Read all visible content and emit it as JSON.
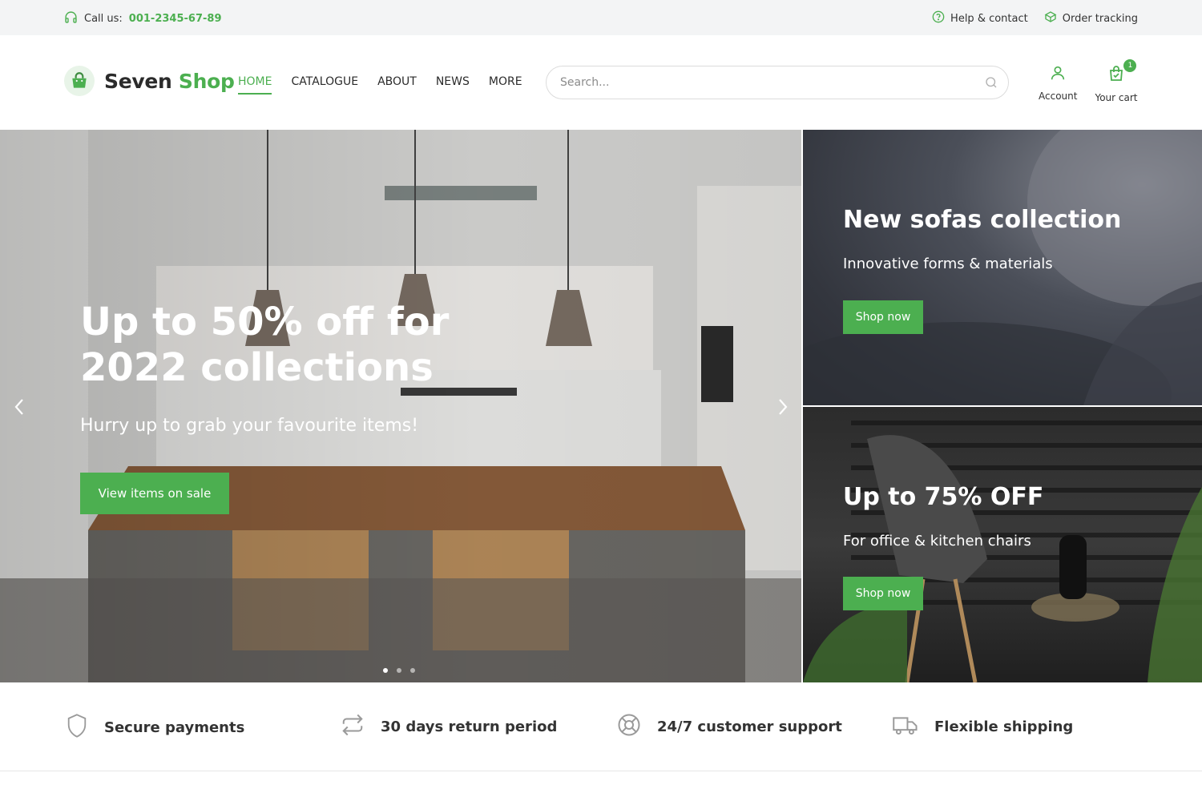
{
  "topbar": {
    "call_label": "Call us:",
    "phone": "001-2345-67-89",
    "help": "Help & contact",
    "tracking": "Order tracking"
  },
  "header": {
    "brand_part1": "Seven",
    "brand_part2": "Shop",
    "nav": [
      "HOME",
      "CATALOGUE",
      "ABOUT",
      "NEWS",
      "MORE"
    ],
    "active_nav": "HOME",
    "search_placeholder": "Search...",
    "account_label": "Account",
    "cart_label": "Your cart",
    "cart_count": "1"
  },
  "hero": {
    "title": "Up to 50% off for 2022 collections",
    "subtitle": "Hurry up to grab your favourite items!",
    "cta": "View items on sale",
    "slide_count": 3,
    "active_slide": 1
  },
  "promos": [
    {
      "title": "New sofas collection",
      "subtitle": "Innovative forms & materials",
      "button": "Shop now"
    },
    {
      "title": "Up to 75% OFF",
      "subtitle": "For office & kitchen chairs",
      "button": "Shop now"
    }
  ],
  "features": [
    {
      "label": "Secure payments",
      "icon": "shield-icon"
    },
    {
      "label": "30 days return period",
      "icon": "return-arrows-icon"
    },
    {
      "label": "24/7 customer support",
      "icon": "lifebuoy-icon"
    },
    {
      "label": "Flexible shipping",
      "icon": "truck-icon"
    }
  ],
  "colors": {
    "accent": "#4caf50",
    "topbar_bg": "#f3f4f5",
    "text": "#2b2b2b"
  }
}
